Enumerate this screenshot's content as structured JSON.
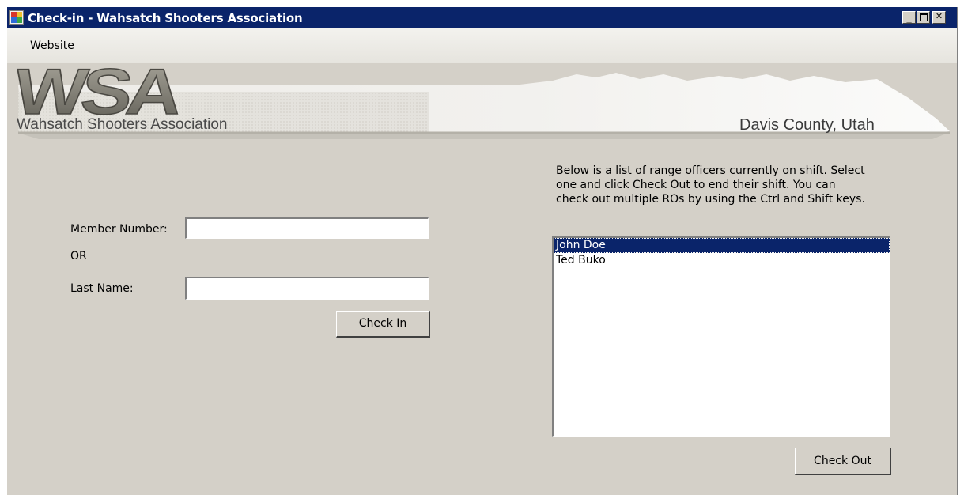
{
  "window": {
    "title": "Check-in - Wahsatch Shooters Association",
    "controls": {
      "minimize": "minimize-icon",
      "maximize": "maximize-icon",
      "close": "close-icon"
    }
  },
  "menu": {
    "items": [
      "Website"
    ]
  },
  "banner": {
    "logo": "WSA",
    "org_name": "Wahsatch Shooters Association",
    "location": "Davis County, Utah"
  },
  "checkin": {
    "member_number_label": "Member Number:",
    "member_number_value": "",
    "or_label": "OR",
    "last_name_label": "Last Name:",
    "last_name_value": "",
    "check_in_label": "Check In"
  },
  "checkout": {
    "instructions": "Below is a list of range officers currently on shift. Select\none and click Check Out to end their shift. You can\ncheck out multiple ROs by using the Ctrl and Shift keys.",
    "officers": [
      {
        "name": "John Doe",
        "selected": true
      },
      {
        "name": "Ted Buko",
        "selected": false
      }
    ],
    "check_out_label": "Check Out"
  },
  "colors": {
    "titlebar": "#0a246a",
    "window_bg": "#d4d0c8",
    "selection": "#0a246a"
  }
}
